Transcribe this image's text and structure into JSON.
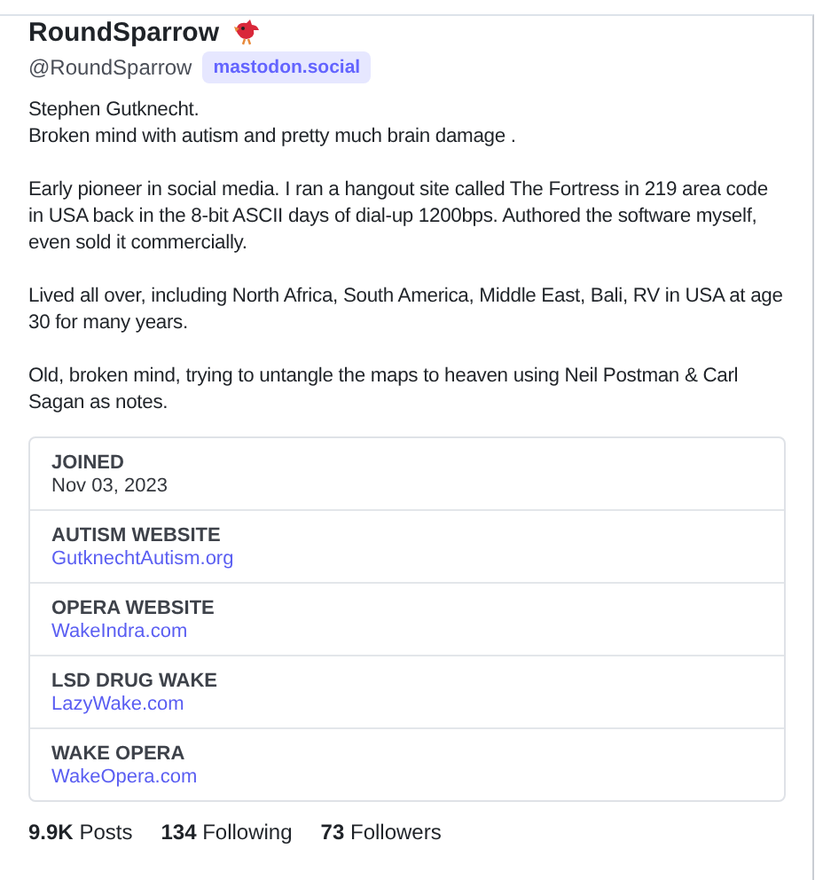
{
  "profile": {
    "display_name": "RoundSparrow",
    "handle": "@RoundSparrow",
    "server_badge": "mastodon.social"
  },
  "bio": [
    "Stephen Gutknecht.\nBroken mind with autism and pretty much brain damage .",
    "Early pioneer in social media. I ran a hangout site called The Fortress in 219 area code in USA back in the 8-bit ASCII days of dial-up 1200bps. Authored the software myself, even sold it commercially.",
    "Lived all over, including North Africa, South America, Middle East, Bali, RV in USA at age 30 for many years.",
    "Old, broken mind, trying to untangle the maps to heaven using Neil Postman & Carl Sagan as notes."
  ],
  "fields": [
    {
      "name": "JOINED",
      "value": "Nov 03, 2023",
      "kind": "text"
    },
    {
      "name": "AUTISM WEBSITE",
      "value": "GutknechtAutism.org",
      "kind": "link"
    },
    {
      "name": "OPERA WEBSITE",
      "value": "WakeIndra.com",
      "kind": "link"
    },
    {
      "name": "LSD DRUG WAKE",
      "value": "LazyWake.com",
      "kind": "link"
    },
    {
      "name": "WAKE OPERA",
      "value": "WakeOpera.com",
      "kind": "link"
    }
  ],
  "stats": [
    {
      "count": "9.9K",
      "label": "Posts"
    },
    {
      "count": "134",
      "label": "Following"
    },
    {
      "count": "73",
      "label": "Followers"
    }
  ]
}
